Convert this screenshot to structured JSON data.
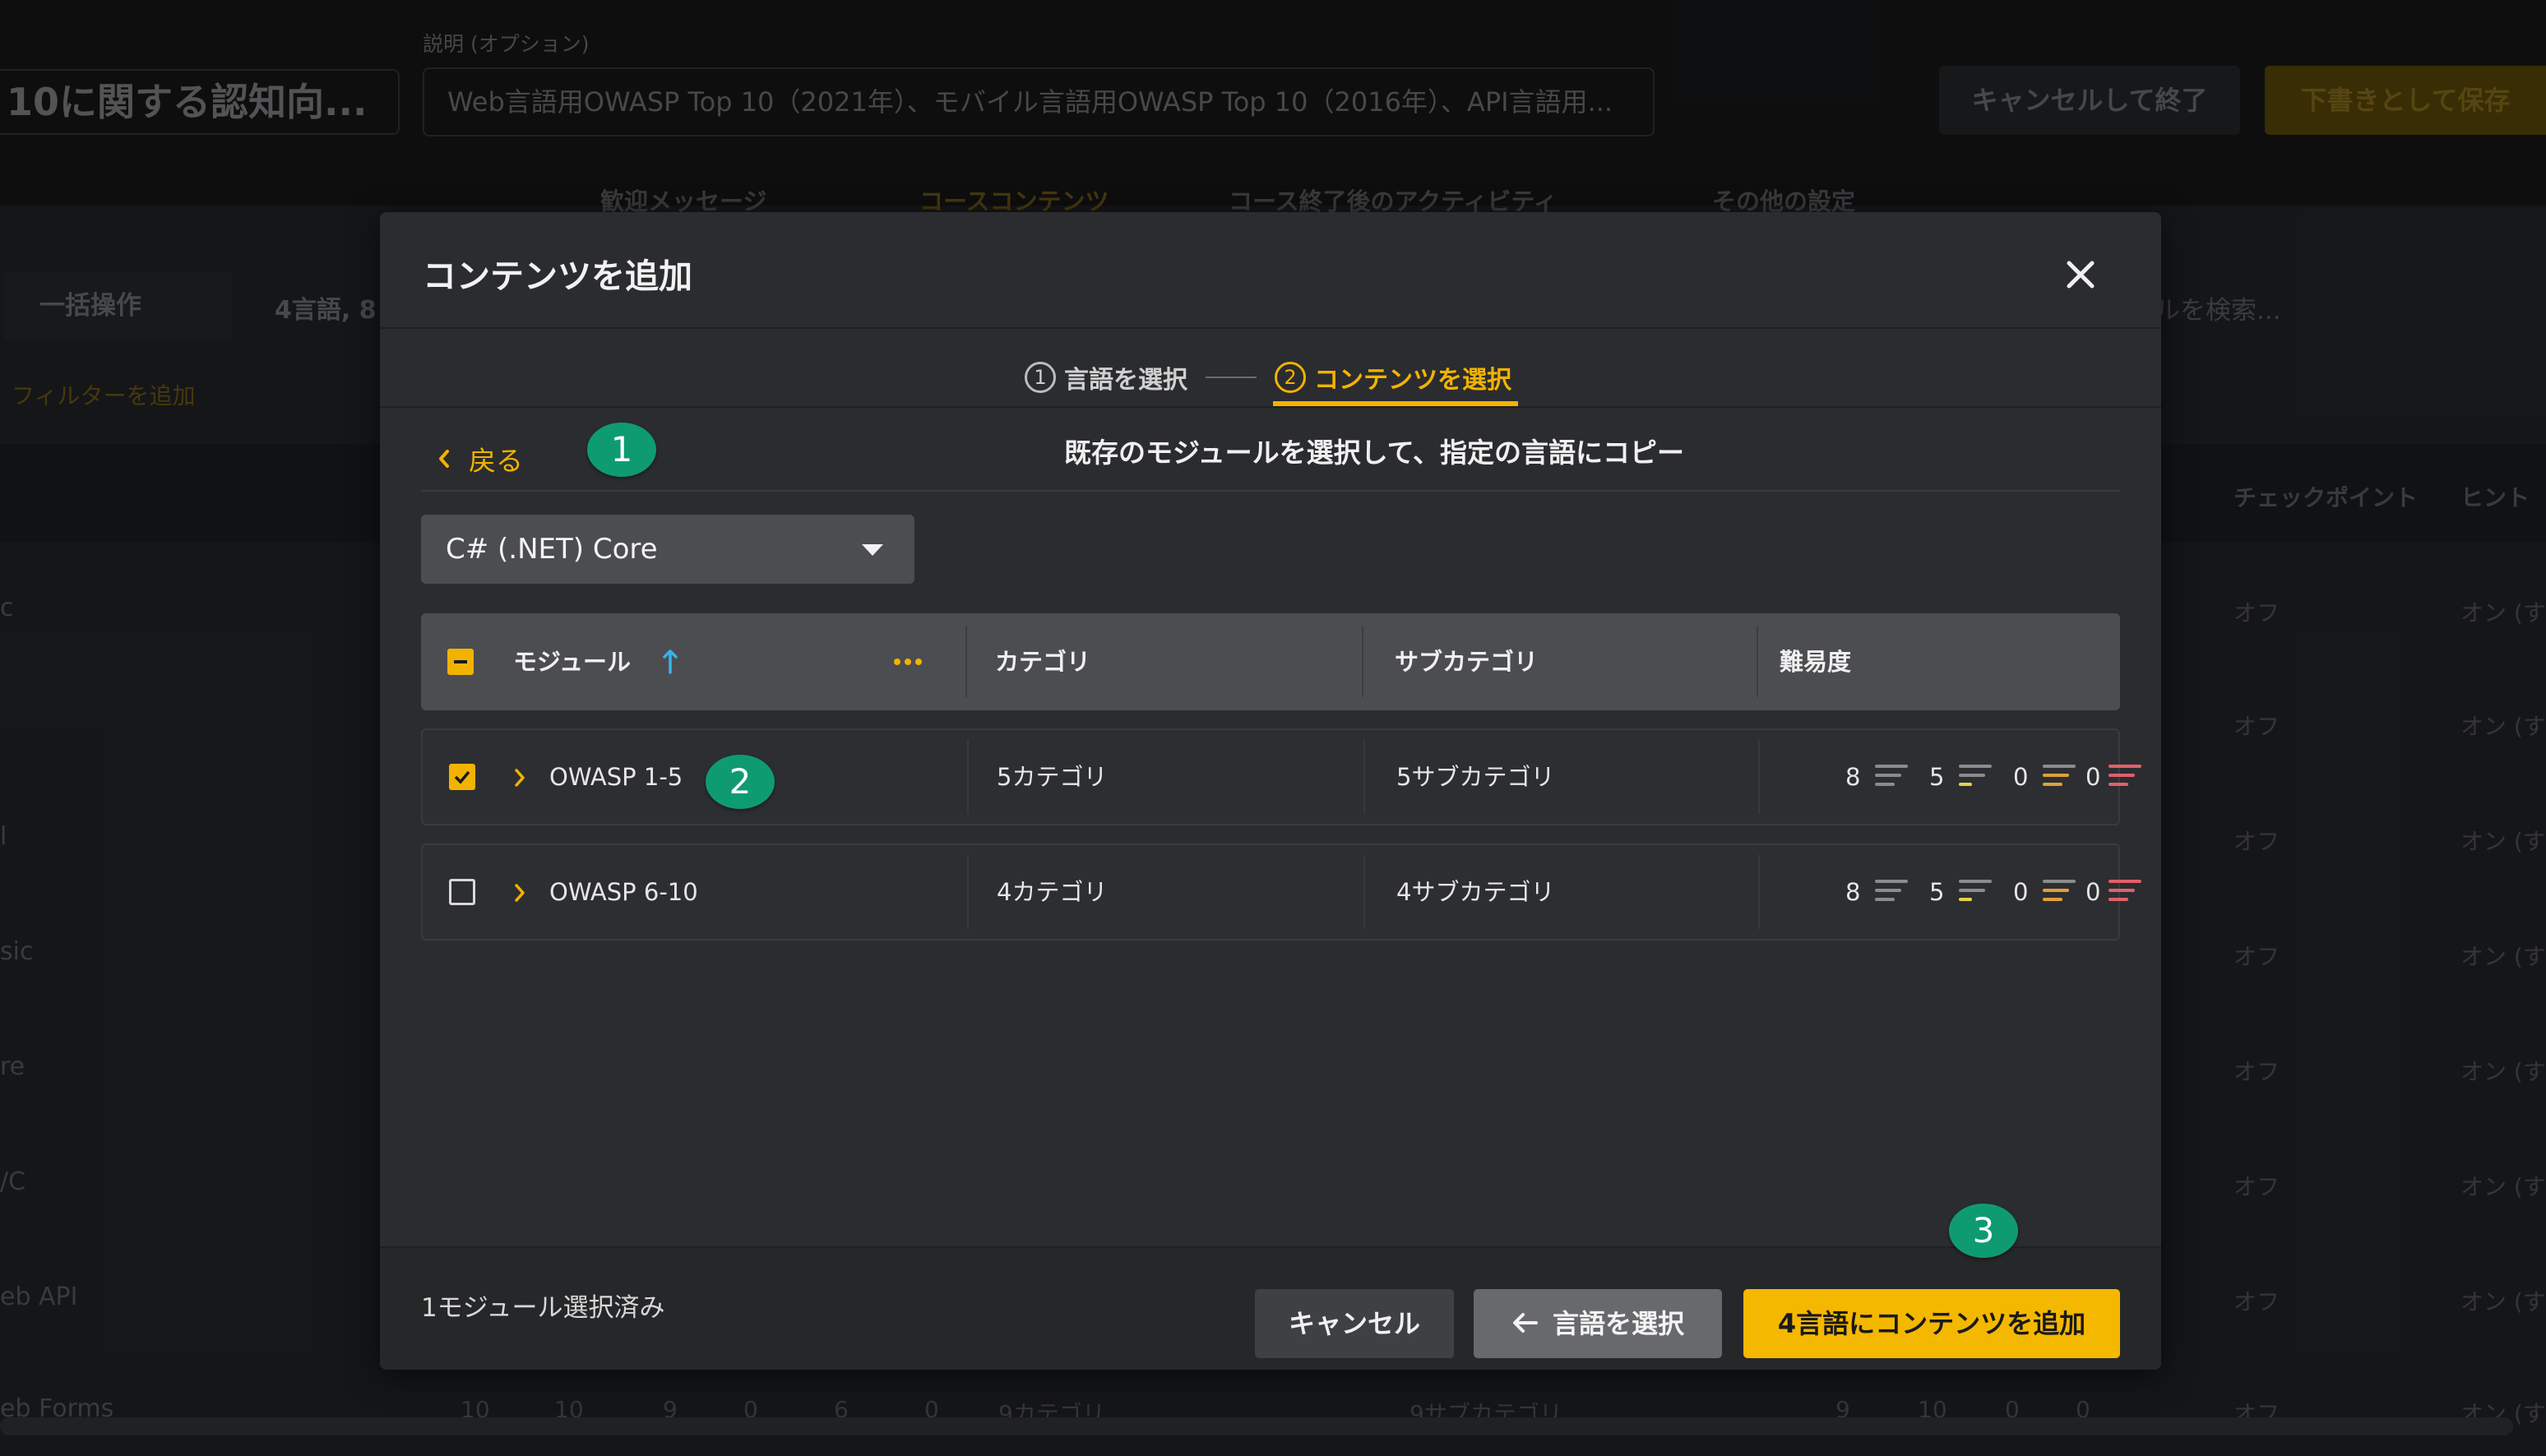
{
  "background": {
    "course_title": "10に関する認知向...",
    "description_label": "説明 (オプション)",
    "description_value": "Web言語用OWASP Top 10（2021年）、モバイル言語用OWASP Top 10（2016年）、API言語用...",
    "cancel_exit_label": "キャンセルして終了",
    "save_draft_label": "下書きとして保存",
    "tabs": [
      "歓迎メッセージ",
      "コースコンテンツ",
      "コース終了後のアクティビティ",
      "その他の設定"
    ],
    "bulk_action_label": "一括操作",
    "count_text": "4言語, 8",
    "filter_label": "フィルターを追加",
    "search_placeholder": "ルを検索...",
    "columns": [
      "チェックポイント",
      "ヒント"
    ],
    "rows": [
      {
        "label": "c",
        "checkpoint": "オフ",
        "hint": "オン (す"
      },
      {
        "label": "",
        "checkpoint": "オフ",
        "hint": "オン (す"
      },
      {
        "label": "l",
        "checkpoint": "オフ",
        "hint": "オン (す"
      },
      {
        "label": "sic",
        "checkpoint": "オフ",
        "hint": "オン (す"
      },
      {
        "label": "re",
        "checkpoint": "オフ",
        "hint": "オン (す"
      },
      {
        "label": "/C",
        "checkpoint": "オフ",
        "hint": "オン (す"
      },
      {
        "label": "eb API",
        "checkpoint": "オフ",
        "hint": "オン (す"
      },
      {
        "label": "eb Forms",
        "checkpoint": "オフ",
        "hint": "オン (す"
      }
    ],
    "last_row_counts": [
      "10",
      "10",
      "9",
      "0",
      "6",
      "0"
    ],
    "last_row_category": "9カテゴリ",
    "last_row_subcategory": "9サブカテゴリ",
    "last_row_difficulty": [
      "9",
      "10",
      "0",
      "0"
    ]
  },
  "modal": {
    "title": "コンテンツを追加",
    "close_icon": "close-icon",
    "steps": [
      {
        "num": "1",
        "label": "言語を選択"
      },
      {
        "num": "2",
        "label": "コンテンツを選択"
      }
    ],
    "back_label": "戻る",
    "instruction": "既存のモジュールを選択して、指定の言語にコピー",
    "language_select": "C# (.NET) Core",
    "table": {
      "headers": {
        "module": "モジュール",
        "category": "カテゴリ",
        "subcategory": "サブカテゴリ",
        "difficulty": "難易度"
      },
      "rows": [
        {
          "checked": true,
          "module": "OWASP 1-5",
          "category": "5カテゴリ",
          "subcategory": "5サブカテゴリ",
          "difficulty": [
            "8",
            "5",
            "0",
            "0"
          ]
        },
        {
          "checked": false,
          "module": "OWASP 6-10",
          "category": "4カテゴリ",
          "subcategory": "4サブカテゴリ",
          "difficulty": [
            "8",
            "5",
            "0",
            "0"
          ]
        }
      ]
    },
    "selected_count": "1モジュール選択済み",
    "buttons": {
      "cancel": "キャンセル",
      "select_language": "言語を選択",
      "add": "4言語にコンテンツを追加"
    },
    "badges": [
      "1",
      "2",
      "3"
    ],
    "colors": {
      "accent": "#f2b300",
      "badge": "#0f9b72",
      "difficulty_easy": "#8a8b8d",
      "difficulty_medium": "#e6d14a",
      "difficulty_hard": "#e0a03a",
      "difficulty_expert": "#e0606a"
    }
  }
}
